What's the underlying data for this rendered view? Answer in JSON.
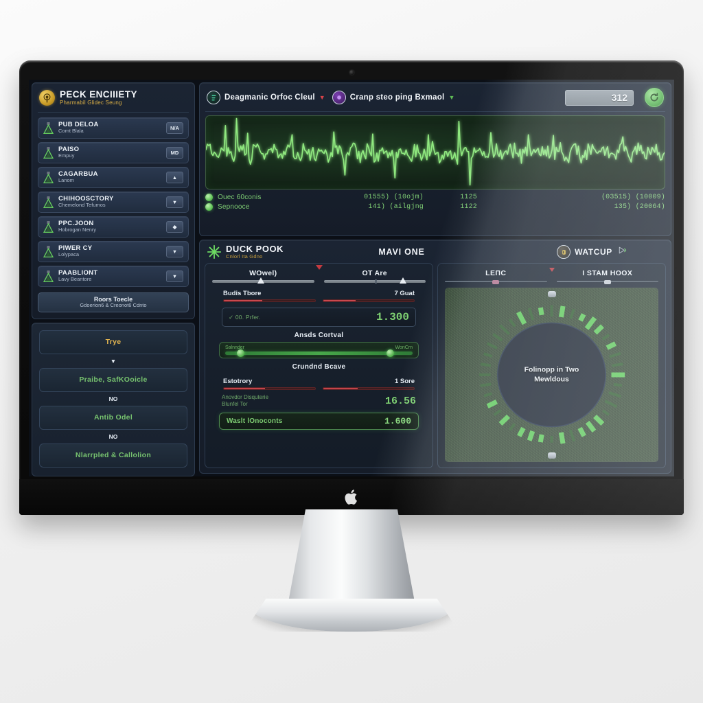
{
  "sidebar": {
    "brand": {
      "title": "PECK ENCIIIETY",
      "subtitle": "Pharmabil Glidec Seung",
      "icon": "target-icon"
    },
    "devices": [
      {
        "name": "PUB DELOA",
        "sub": "Comt Blala",
        "badge": "N/A",
        "icon": "flask-icon"
      },
      {
        "name": "PAISO",
        "sub": "Empuy",
        "badge": "MD",
        "icon": "flask-icon"
      },
      {
        "name": "CAGARBUA",
        "sub": "Lanom",
        "badge": "▲",
        "icon": "flask-icon"
      },
      {
        "name": "CHIHOOSCTORY",
        "sub": "Chemelond Tefumos",
        "badge": "▼",
        "icon": "flask-icon"
      },
      {
        "name": "PPC.JOON",
        "sub": "Hobrogan Nenry",
        "badge": "◆",
        "icon": "flask-icon"
      },
      {
        "name": "PIWER CY",
        "sub": "Lolypaca",
        "badge": "▼",
        "icon": "flask-icon"
      },
      {
        "name": "PAABLIONT",
        "sub": "Lavy Beantore",
        "badge": "▼",
        "icon": "flask-icon"
      }
    ],
    "action": {
      "title": "Roors Toecle",
      "subtitle": "Gdoerion6 & Creonot6 Cdnto"
    },
    "stack": {
      "items": [
        {
          "label": "Trye",
          "style": "gold"
        },
        {
          "label": "Praibe, SafKOoicle",
          "style": "green"
        },
        {
          "label": "Antib Odel",
          "style": "green"
        },
        {
          "label": "Nlarrpled & Callolion",
          "style": "green"
        }
      ],
      "connectors": [
        "▼",
        "NO",
        "NO"
      ]
    }
  },
  "scope": {
    "toolbar": {
      "left": {
        "label": "Deagmanic Orfoc Cleul",
        "caret": "▼",
        "caret_color": "red",
        "icon": "signal-badge-icon"
      },
      "right": {
        "label": "Cranp steo ping Bxmaol",
        "caret": "▼",
        "caret_color": "green",
        "icon": "orb-badge-icon"
      },
      "value": "312",
      "refresh_icon": "refresh-icon"
    },
    "waveform": {
      "stroke": "#8fe87f",
      "glow": "#55c24e"
    },
    "legend": [
      {
        "name": "Ouec 60conis",
        "a": "01555) (10ojm)",
        "b": "1125",
        "c": "(03515) (10009)"
      },
      {
        "name": "Sepnooce",
        "a": "141) (ailgjng",
        "b": "1122",
        "c": "135) (20064)"
      }
    ]
  },
  "control": {
    "toolbar": {
      "title": "DUCK POOK",
      "subtitle": "Cnlorl Ita Gdno",
      "icon": "starburst-icon",
      "center": "MAVI ONE",
      "right_label": "WATCUP",
      "right_icon": "watch-badge-icon"
    },
    "left_card": {
      "sliders": [
        {
          "label": "WOwel)",
          "knob_pct": 48
        },
        {
          "label": "OT Are",
          "knob_pct": 78
        }
      ],
      "mini": [
        {
          "label": "Budis Tbore",
          "fill_pct": 42
        },
        {
          "label": "7 Guat",
          "fill_pct": 36
        }
      ],
      "readout": {
        "label": "✓ 00. Prfer.",
        "value": "1.300"
      },
      "section_title": "Ansds Cortval",
      "green_strip": {
        "left": "Salnnder",
        "right": "WonCrn",
        "knob_left_pct": 8,
        "knob_right_pct": 88
      },
      "section_title2": "Crundnd Bcave",
      "mini2": [
        {
          "label": "Estotrory",
          "fill_pct": 45
        },
        {
          "label": "1 Sore",
          "fill_pct": 38
        }
      ],
      "readout2": {
        "label": "Anovdor Disquterie\nBlunfel Tor",
        "value": "16.56"
      },
      "final": {
        "label": "Waslt lOnoconts",
        "value": "1.600"
      }
    },
    "right_card": {
      "head": [
        {
          "label": "LEПC",
          "mark_color": "#b4738f"
        },
        {
          "label": "I STAM HOOX",
          "mark_color": "#c9cfd6",
          "caret": "▼",
          "caret_color": "#6fb567"
        }
      ],
      "dial": {
        "center_line1": "Folinopp in Two",
        "center_line2": "Mewldous",
        "tick_count": 40,
        "active_color": "#5fd25a",
        "dim_color": "#2f5b2e"
      }
    }
  },
  "hardware": {
    "logo": "apple-logo",
    "webcam": "webcam-icon"
  }
}
